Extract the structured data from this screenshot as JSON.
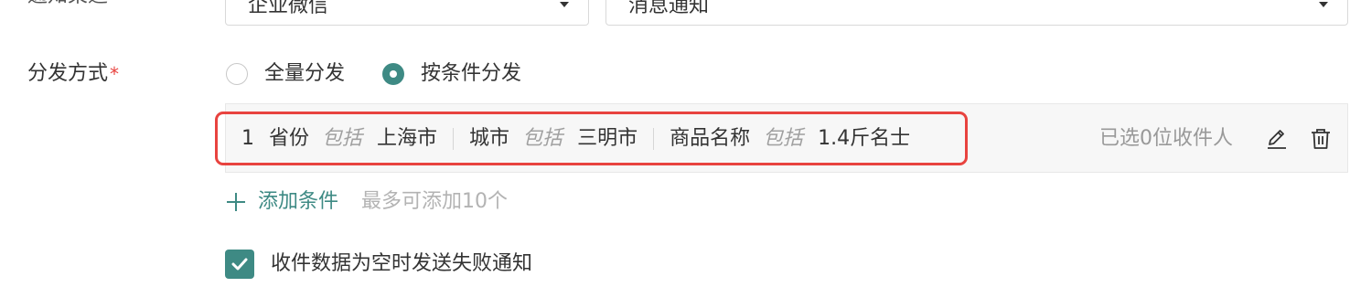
{
  "notify": {
    "label": "通知渠道",
    "channel_value": "企业微信",
    "type_value": "消息通知"
  },
  "distribution": {
    "label": "分发方式",
    "required_mark": "*",
    "options": [
      {
        "label": "全量分发",
        "selected": false
      },
      {
        "label": "按条件分发",
        "selected": true
      }
    ]
  },
  "conditions": {
    "index": "1",
    "items": [
      {
        "field": "省份",
        "operator": "包括",
        "value": "上海市"
      },
      {
        "field": "城市",
        "operator": "包括",
        "value": "三明市"
      },
      {
        "field": "商品名称",
        "operator": "包括",
        "value": "1.4斤名士"
      }
    ],
    "recipients_text": "已选0位收件人",
    "icons": [
      "edit-icon",
      "trash-icon"
    ]
  },
  "add_condition": {
    "label": "添加条件",
    "hint": "最多可添加10个"
  },
  "fail_notice": {
    "label": "收件数据为空时发送失败通知",
    "checked": true
  },
  "colors": {
    "accent": "#3e8a84",
    "highlight": "#e8433f",
    "muted": "#999999"
  }
}
